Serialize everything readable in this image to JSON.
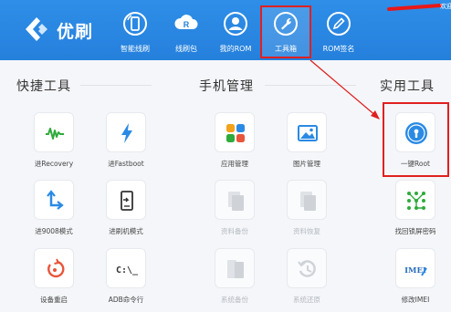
{
  "app": {
    "brand": "优刷",
    "corner_text": "欢迎"
  },
  "nav": [
    {
      "label": "智能线刷",
      "icon": "phone-refresh-icon"
    },
    {
      "label": "线刷包",
      "icon": "rom-package-icon"
    },
    {
      "label": "我的ROM",
      "icon": "user-icon"
    },
    {
      "label": "工具箱",
      "icon": "wrench-icon",
      "active": true
    },
    {
      "label": "ROM签名",
      "icon": "pen-icon"
    }
  ],
  "sections": {
    "quick_tools": "快捷工具",
    "phone_manage": "手机管理",
    "utility_tools": "实用工具"
  },
  "quick_tools": [
    {
      "label": "进Recovery",
      "icon": "recovery-wave-icon"
    },
    {
      "label": "进Fastboot",
      "icon": "lightning-icon"
    },
    {
      "label": "进9008模式",
      "icon": "arrow-down-icon"
    },
    {
      "label": "进刷机模式",
      "icon": "phone-flash-icon"
    },
    {
      "label": "设备重启",
      "icon": "restart-icon"
    },
    {
      "label": "ADB命令行",
      "icon": "terminal-icon",
      "glyph": "C:\\_"
    }
  ],
  "phone_manage": [
    {
      "label": "应用管理",
      "icon": "apps-icon",
      "enabled": true
    },
    {
      "label": "图片管理",
      "icon": "image-icon",
      "enabled": true
    },
    {
      "label": "资料备份",
      "icon": "doc-backup-icon",
      "enabled": false
    },
    {
      "label": "资料恢复",
      "icon": "doc-restore-icon",
      "enabled": false
    },
    {
      "label": "系统备份",
      "icon": "system-backup-icon",
      "enabled": false
    },
    {
      "label": "系统还原",
      "icon": "system-restore-icon",
      "enabled": false
    }
  ],
  "utility_tools": [
    {
      "label": "一键Root",
      "icon": "root-lock-icon"
    },
    {
      "label": "找回锁屏密码",
      "icon": "pattern-lock-icon"
    },
    {
      "label": "修改IMEI",
      "icon": "imei-icon",
      "glyph": "IMEI"
    }
  ],
  "colors": {
    "header": "#2580dc",
    "accent": "#2a8ae4",
    "highlight": "#e02020"
  }
}
